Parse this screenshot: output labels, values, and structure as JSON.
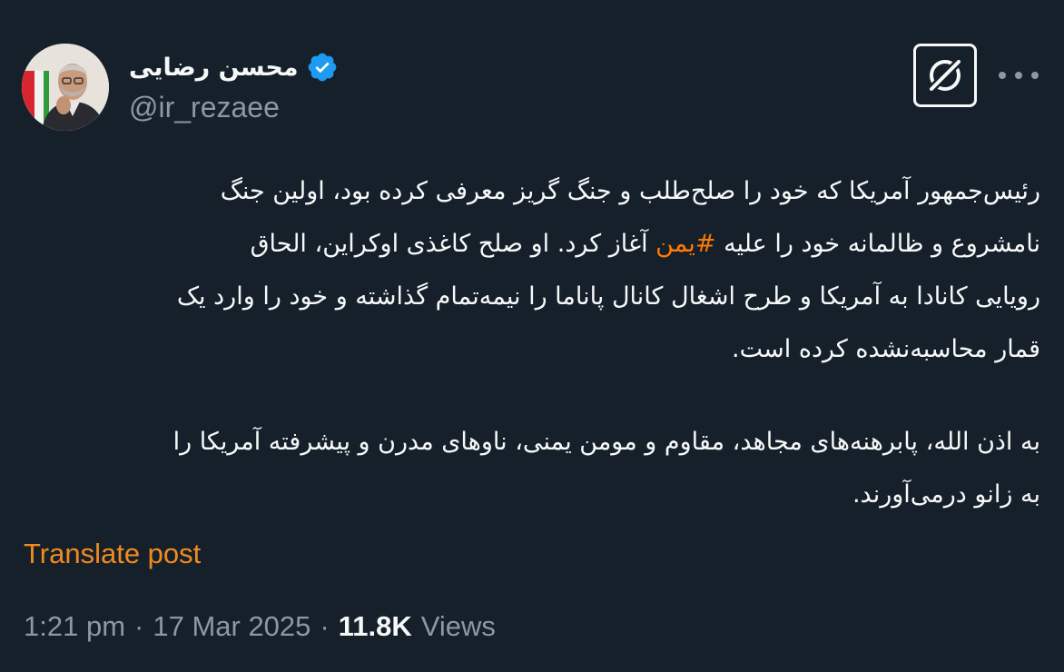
{
  "author": {
    "display_name": "محسن رضایی",
    "handle": "@ir_rezaee",
    "verified": true,
    "verified_color": "#1d9bf0"
  },
  "header_actions": {
    "grok_icon": "grok-icon",
    "more_icon": "more-horizontal-icon"
  },
  "tweet": {
    "paragraph1": [
      [
        "رئیس‌جمهور آمریکا که خود را صلح‌طلب و جنگ گریز معرفی کرده بود، اولین جنگ"
      ],
      [
        "نامشروع و ظالمانه خود را علیه ",
        "#یمن",
        " آغاز کرد. او صلح کاغذی اوکراین، الحاق"
      ],
      [
        "رویایی کانادا به آمریکا و طرح اشغال کانال پاناما را نیمه‌تمام گذاشته و خود را وارد یک"
      ],
      [
        "قمار محاسبه‌نشده کرده است."
      ]
    ],
    "paragraph2": [
      [
        "به اذن الله، پابرهنه‌های مجاهد، مقاوم و مومن یمنی، ناوهای مدرن و پیشرفته آمریکا را"
      ],
      [
        "به زانو درمی‌آورند."
      ]
    ],
    "hashtag_color": "#ff7a00"
  },
  "translate_label": "Translate post",
  "meta": {
    "time": "1:21 pm",
    "separator": "·",
    "date": "17 Mar 2025",
    "views_count": "11.8K",
    "views_label": "Views"
  },
  "colors": {
    "background": "#15202b",
    "text": "#f7f9f9",
    "secondary": "#8b98a5",
    "accent": "#f18a1f"
  }
}
